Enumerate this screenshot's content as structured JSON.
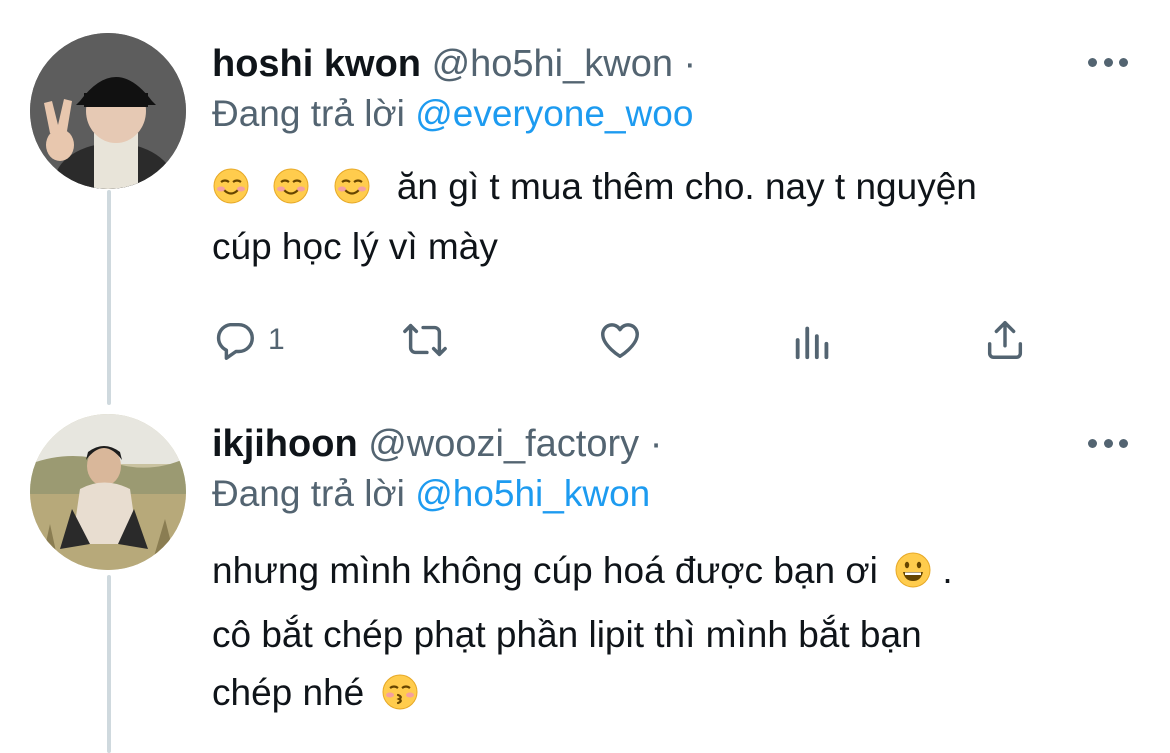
{
  "tweets": [
    {
      "name": "hoshi kwon",
      "handle": "@ho5hi_kwon",
      "separator": "·",
      "replying_label": "Đang trả lời",
      "replying_to": "@everyone_woo",
      "text_line1": "ăn gì t mua thêm cho. nay t nguyện",
      "text_line2": "cúp học lý vì mày",
      "reply_count": "1",
      "emojis": [
        "relieved-smile-emoji",
        "relieved-smile-emoji",
        "relieved-smile-emoji"
      ]
    },
    {
      "name": "ikjihoon",
      "handle": "@woozi_factory",
      "separator": "·",
      "replying_label": "Đang trả lời",
      "replying_to": "@ho5hi_kwon",
      "text_line1": "nhưng mình không cúp hoá được bạn ơi",
      "text_line1_end": " .",
      "text_line2": "cô bắt chép phạt phần lipit thì mình bắt bạn",
      "text_line3": "chép nhé",
      "emojis": [
        "grinning-emoji",
        "kissing-emoji"
      ]
    }
  ],
  "colors": {
    "text": "#0f1419",
    "secondary": "#536471",
    "accent": "#1d9bf0",
    "thread_line": "#cfd9de"
  },
  "icons": [
    "reply-icon",
    "retweet-icon",
    "like-icon",
    "analytics-icon",
    "share-icon",
    "more-icon"
  ]
}
